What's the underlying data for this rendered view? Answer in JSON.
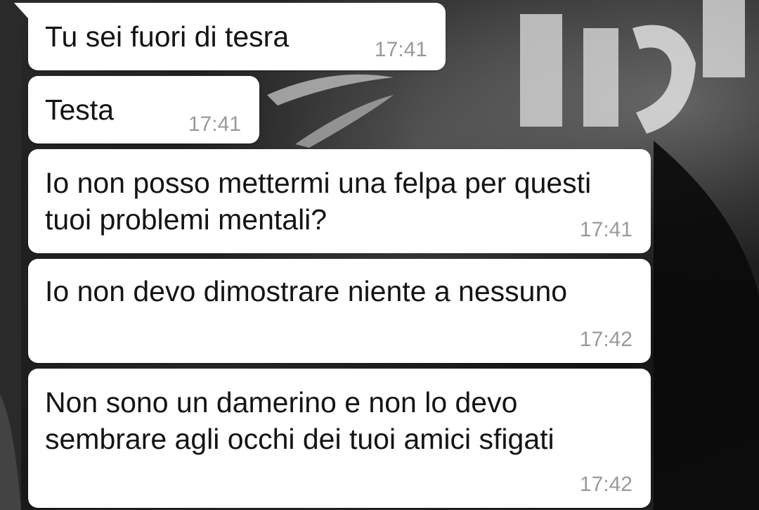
{
  "conversation": {
    "messages": [
      {
        "text": "Tu sei fuori di tesra",
        "time": "17:41"
      },
      {
        "text": "Testa",
        "time": "17:41"
      },
      {
        "text": "Io non posso mettermi una felpa per questi\ntuoi problemi mentali?",
        "time": "17:41"
      },
      {
        "text": "Io non devo dimostrare niente a nessuno",
        "time": "17:42"
      },
      {
        "text": "Non sono un damerino e non lo devo\nsembrare agli occhi dei tuoi amici sfigati",
        "time": "17:42"
      }
    ]
  },
  "colors": {
    "bubble": "#ffffff",
    "timestamp": "#9a9a9a",
    "text": "#141414"
  }
}
